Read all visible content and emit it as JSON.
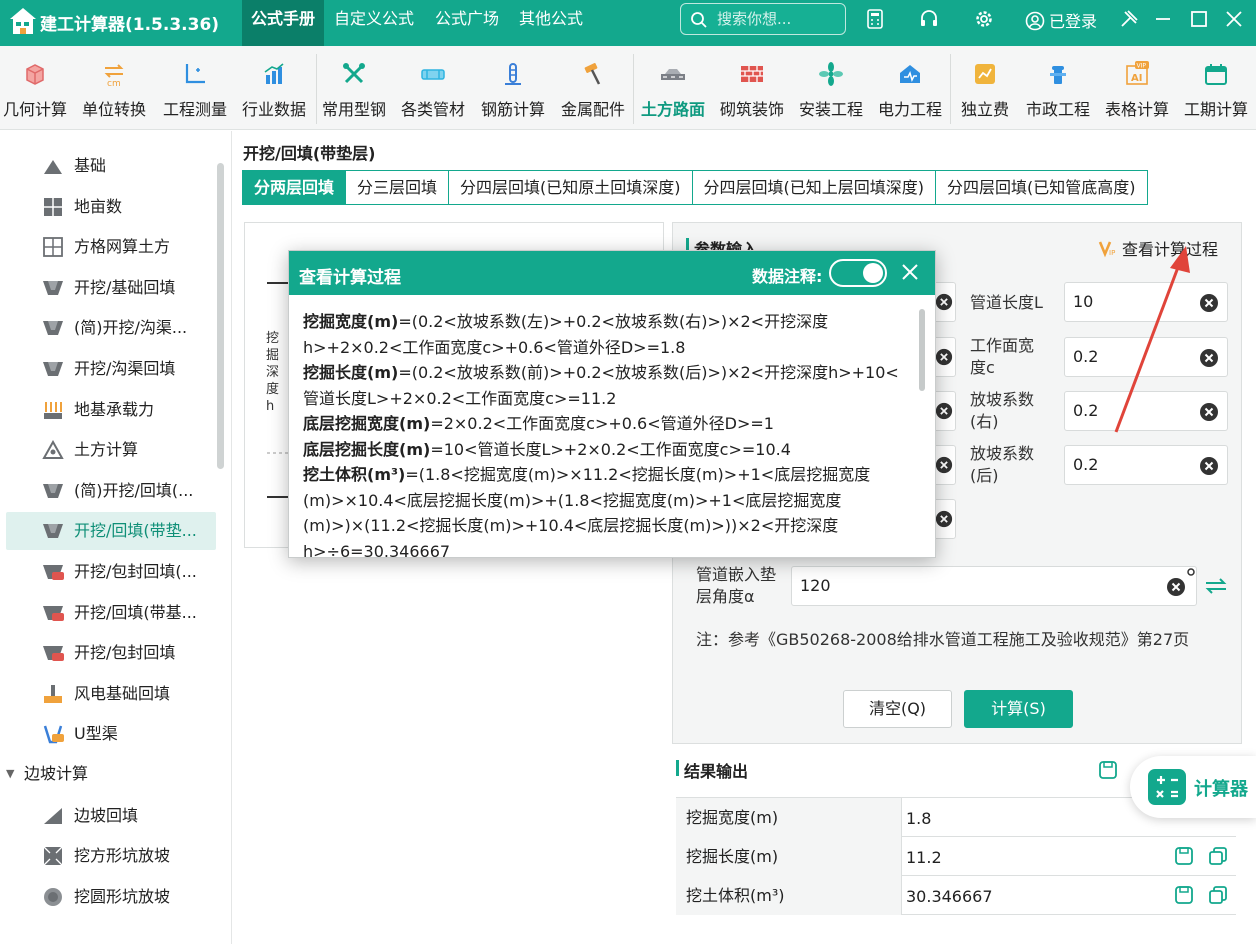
{
  "app": {
    "title": "建工计算器(1.5.3.36)"
  },
  "menu": [
    "公式手册",
    "自定义公式",
    "公式广场",
    "其他公式"
  ],
  "search": {
    "placeholder": "搜索你想..."
  },
  "login": {
    "label": "已登录"
  },
  "toolbar": [
    {
      "label": "几何计算",
      "icon": "cube-icon",
      "color": "#e06a6a"
    },
    {
      "label": "单位转换",
      "icon": "unit-convert-icon",
      "color": "#f0a23c"
    },
    {
      "label": "工程测量",
      "icon": "axis-measure-icon",
      "color": "#2f8fe0"
    },
    {
      "label": "行业数据",
      "icon": "bar-chart-icon",
      "color": "#2f8fe0"
    },
    {
      "label": "常用型钢",
      "icon": "tools-icon",
      "color": "#13a88d"
    },
    {
      "label": "各类管材",
      "icon": "pipe-icon",
      "color": "#2fb4e0"
    },
    {
      "label": "钢筋计算",
      "icon": "rebar-icon",
      "color": "#3a7fd8"
    },
    {
      "label": "金属配件",
      "icon": "hammer-icon",
      "color": "#f0a23c"
    },
    {
      "label": "土方路面",
      "icon": "road-icon",
      "color": "#7b7f86"
    },
    {
      "label": "砌筑装饰",
      "icon": "brick-icon",
      "color": "#e0554f"
    },
    {
      "label": "安装工程",
      "icon": "fan-icon",
      "color": "#13a88d"
    },
    {
      "label": "电力工程",
      "icon": "power-icon",
      "color": "#2f8fe0"
    },
    {
      "label": "独立费",
      "icon": "chart-card-icon",
      "color": "#f0b43c"
    },
    {
      "label": "市政工程",
      "icon": "hydrant-icon",
      "color": "#2f8fe0"
    },
    {
      "label": "表格计算",
      "icon": "vip-ai-table-icon",
      "color": "#f0a23c"
    },
    {
      "label": "工期计算",
      "icon": "calendar-icon",
      "color": "#13a88d"
    }
  ],
  "sidebar": {
    "items": [
      {
        "label": "基础",
        "icon": "foundation-icon"
      },
      {
        "label": "地亩数",
        "icon": "grid-icon"
      },
      {
        "label": "方格网算土方",
        "icon": "mesh-icon"
      },
      {
        "label": "开挖/基础回填",
        "icon": "trench-icon"
      },
      {
        "label": "(简)开挖/沟渠...",
        "icon": "trench-icon"
      },
      {
        "label": "开挖/沟渠回填",
        "icon": "trench-icon"
      },
      {
        "label": "地基承载力",
        "icon": "bearing-icon"
      },
      {
        "label": "土方计算",
        "icon": "triangle-icon"
      },
      {
        "label": "(简)开挖/回填(...",
        "icon": "trench-icon"
      },
      {
        "label": "开挖/回填(带垫...",
        "icon": "trench-icon"
      },
      {
        "label": "开挖/包封回填(...",
        "icon": "trench-vip-icon"
      },
      {
        "label": "开挖/回填(带基...",
        "icon": "trench-vip-icon"
      },
      {
        "label": "开挖/包封回填",
        "icon": "trench-vip-icon"
      },
      {
        "label": "风电基础回填",
        "icon": "wind-base-icon"
      },
      {
        "label": "U型渠",
        "icon": "u-channel-vip-icon"
      }
    ],
    "group": "边坡计算",
    "group_items": [
      {
        "label": "边坡回填",
        "icon": "slope-icon"
      },
      {
        "label": "挖方形坑放坡",
        "icon": "square-pit-icon"
      },
      {
        "label": "挖圆形坑放坡",
        "icon": "round-pit-icon"
      }
    ]
  },
  "page": {
    "title": "开挖/回填(带垫层)",
    "tabs": [
      "分两层回填",
      "分三层回填",
      "分四层回填(已知原土回填深度)",
      "分四层回填(已知上层回填深度)",
      "分四层回填(已知管底高度)"
    ]
  },
  "diagram": {
    "label": "挖掘深度h"
  },
  "params": {
    "section_title": "参数输入",
    "view_process": "查看计算过程",
    "fields": [
      {
        "label": "管道长度L",
        "value": "10"
      },
      {
        "label": "工作面宽度c",
        "value": "0.2"
      },
      {
        "label": "放坡系数(右)",
        "value": "0.2"
      },
      {
        "label": "放坡系数(后)",
        "value": "0.2"
      }
    ],
    "angle": {
      "label": "管道嵌入垫层角度α",
      "value": "120"
    },
    "note": "注：参考《GB50268-2008给排水管道工程施工及验收规范》第27页",
    "clear_btn": "清空(Q)",
    "calc_btn": "计算(S)"
  },
  "results": {
    "title": "结果输出",
    "rows": [
      {
        "label": "挖掘宽度(m)",
        "value": "1.8"
      },
      {
        "label": "挖掘长度(m)",
        "value": "11.2"
      },
      {
        "label": "挖土体积(m³)",
        "value": "30.346667"
      }
    ]
  },
  "float_btn": {
    "label": "计算器"
  },
  "dialog": {
    "title": "查看计算过程",
    "annotation_label": "数据注释:",
    "toggle_on": true,
    "lines": [
      {
        "name": "挖掘宽度(m)",
        "expr": "=(0.2<放坡系数(左)>+0.2<放坡系数(右)>)×2<开挖深度h>+2×0.2<工作面宽度c>+0.6<管道外径D>=1.8"
      },
      {
        "name": "挖掘长度(m)",
        "expr": "=(0.2<放坡系数(前)>+0.2<放坡系数(后)>)×2<开挖深度h>+10<管道长度L>+2×0.2<工作面宽度c>=11.2"
      },
      {
        "name": "底层挖掘宽度(m)",
        "expr": "=2×0.2<工作面宽度c>+0.6<管道外径D>=1"
      },
      {
        "name": "底层挖掘长度(m)",
        "expr": "=10<管道长度L>+2×0.2<工作面宽度c>=10.4"
      },
      {
        "name": "挖土体积(m³)",
        "expr": "=(1.8<挖掘宽度(m)>×11.2<挖掘长度(m)>+1<底层挖掘宽度(m)>×10.4<底层挖掘长度(m)>+(1.8<挖掘宽度(m)>+1<底层挖掘宽度(m)>)×(11.2<挖掘长度(m)>+10.4<底层挖掘长度(m)>))×2<开挖深度h>÷6=30.346667"
      }
    ]
  },
  "colors": {
    "primary": "#13a88d",
    "primary_dark": "#0b7f69",
    "arrow": "#e0443a"
  }
}
